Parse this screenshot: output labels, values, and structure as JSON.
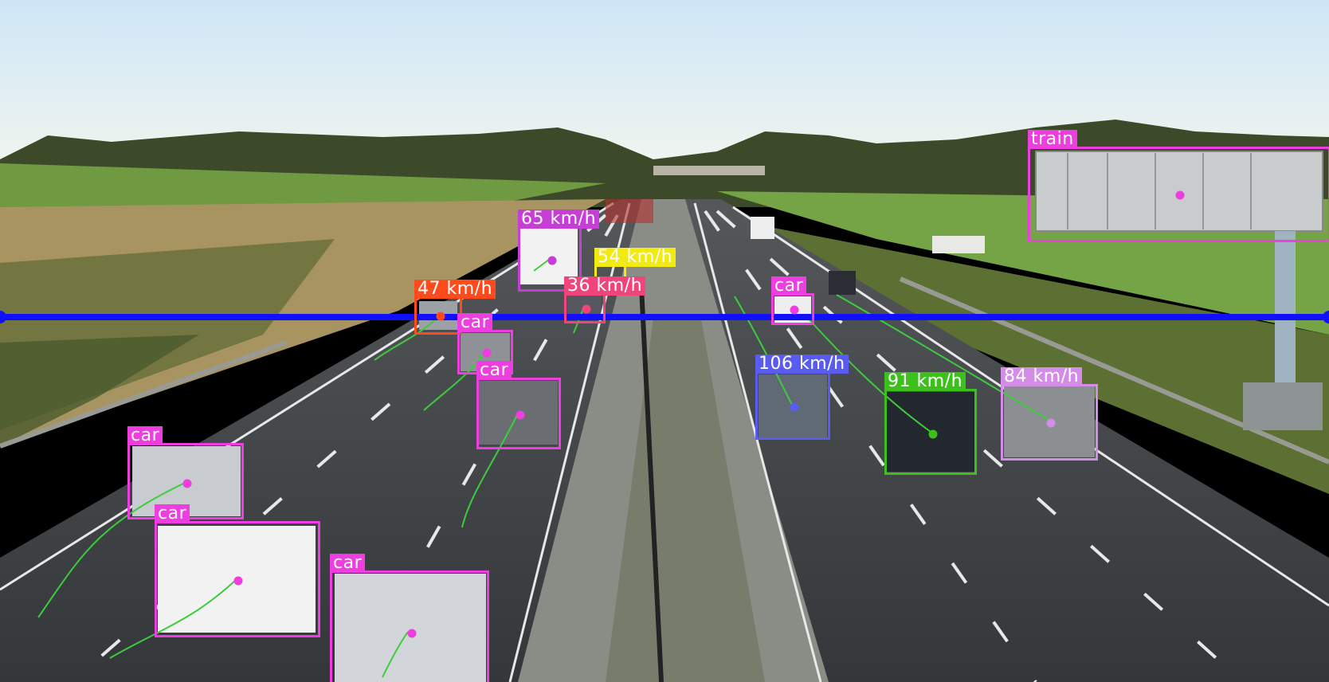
{
  "colors": {
    "sky_top": "#d8ecf8",
    "sky_bottom": "#f2f6f2",
    "road": "#3b3e40",
    "grass": "#6f9e3e",
    "trees": "#3a4a28",
    "counting_line": "#1010ff",
    "trail": "#3ecc3e"
  },
  "counting_line": {
    "name": "counting-line"
  },
  "detections": [
    {
      "id": "det-train",
      "label": "train",
      "kind": "class",
      "color": "#ee3ee0"
    },
    {
      "id": "det-65",
      "label": "65 km/h",
      "kind": "speed",
      "color": "#c63ed6"
    },
    {
      "id": "det-54",
      "label": "54 km/h",
      "kind": "speed",
      "color": "#f2ea10",
      "label_color": "#ffffff"
    },
    {
      "id": "det-47",
      "label": "47 km/h",
      "kind": "speed",
      "color": "#ff4a1c"
    },
    {
      "id": "det-36",
      "label": "36 km/h",
      "kind": "speed",
      "color": "#f0447a"
    },
    {
      "id": "det-car-a",
      "label": "car",
      "kind": "class",
      "color": "#ee3ee0"
    },
    {
      "id": "det-car-b",
      "label": "car",
      "kind": "class",
      "color": "#ee3ee0"
    },
    {
      "id": "det-car-c",
      "label": "car",
      "kind": "class",
      "color": "#ee3ee0"
    },
    {
      "id": "det-106",
      "label": "106 km/h",
      "kind": "speed",
      "color": "#5a5cf0"
    },
    {
      "id": "det-91",
      "label": "91 km/h",
      "kind": "speed",
      "color": "#3ec01c"
    },
    {
      "id": "det-84",
      "label": "84 km/h",
      "kind": "speed",
      "color": "#d48ce8"
    },
    {
      "id": "det-car-d",
      "label": "car",
      "kind": "class",
      "color": "#ee3ee0"
    },
    {
      "id": "det-car-e",
      "label": "car",
      "kind": "class",
      "color": "#ee3ee0"
    },
    {
      "id": "det-car-f",
      "label": "car",
      "kind": "class",
      "color": "#ee3ee0"
    },
    {
      "id": "det-car-g",
      "label": "car",
      "kind": "class",
      "color": "#ee3ee0"
    }
  ]
}
